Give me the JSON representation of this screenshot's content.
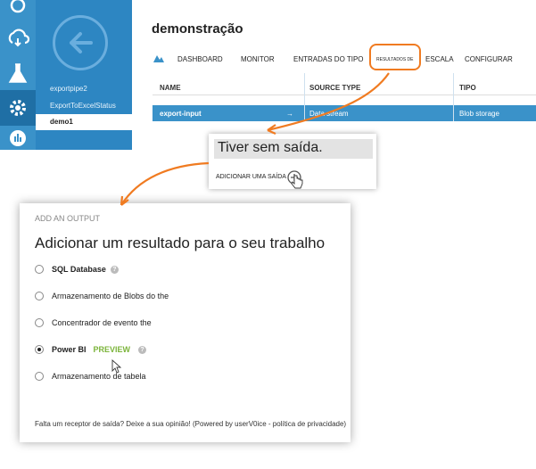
{
  "leftnav": {
    "icons": [
      "cloud-service-icon",
      "flask-icon",
      "gear-icon",
      "chart-icon"
    ]
  },
  "subnav": {
    "items": [
      {
        "label": "exportpipe2"
      },
      {
        "label": "ExportToExcelStatus"
      },
      {
        "label": "demo1"
      }
    ]
  },
  "header": {
    "title": "demonstração",
    "tabs": [
      "DASHBOARD",
      "MONITOR",
      "ENTRADAS DO TIPO",
      "RESULTADOS DE",
      "ESCALA",
      "CONFIGURAR"
    ]
  },
  "grid": {
    "columns": [
      "NAME",
      "SOURCE TYPE",
      "TIPO"
    ],
    "rows": [
      {
        "name": "export-input",
        "source": "Data stream",
        "type": "Blob storage"
      }
    ]
  },
  "zoom": {
    "title": "Tiver sem saída.",
    "link": "ADICIONAR UMA SAÍDA"
  },
  "dialog": {
    "subtitle": "ADD AN OUTPUT",
    "title": "Adicionar um resultado para o seu trabalho",
    "options": [
      {
        "label": "SQL Database",
        "bold": true,
        "help": true
      },
      {
        "label": "Armazenamento de Blobs do the"
      },
      {
        "label": "Concentrador de evento the"
      },
      {
        "label": "Power BI",
        "bold": true,
        "selected": true,
        "badge": "PREVIEW",
        "help": true
      },
      {
        "label": "Armazenamento de tabela"
      }
    ],
    "footer": "Falta um receptor de saída? Deixe a sua opinião! (Powered by userV0ice - política de privacidade)"
  },
  "colors": {
    "accent": "#3a92c9",
    "highlight": "#f07b21",
    "preview": "#7bb43a"
  }
}
